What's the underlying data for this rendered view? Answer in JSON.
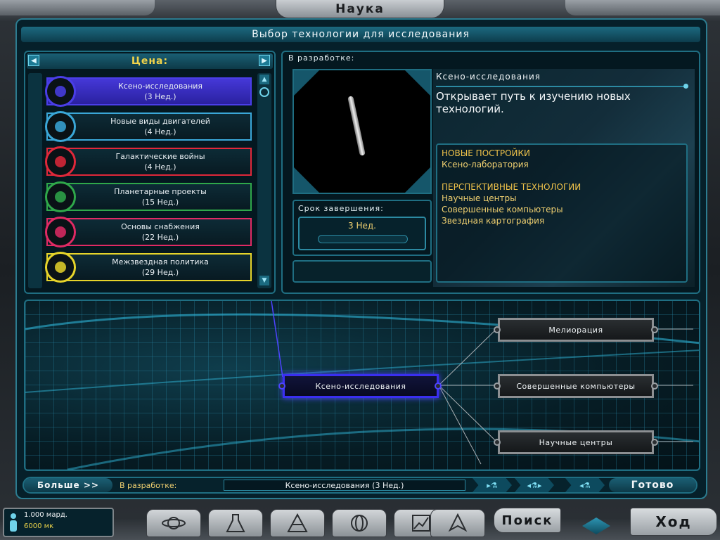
{
  "window": {
    "title": "Наука"
  },
  "header": {
    "title": "Выбор технологии для исследования"
  },
  "list": {
    "header": "Цена:",
    "prev_arrow": "◀",
    "next_arrow": "▶",
    "items": [
      {
        "name": "Ксено-исследования",
        "cost": "(3 Нед.)",
        "color": "#4a3ee8",
        "selected": true,
        "icon": "tablet-icon"
      },
      {
        "name": "Новые виды двигателей",
        "cost": "(4 Нед.)",
        "color": "#3aa7d8",
        "icon": "engine-icon"
      },
      {
        "name": "Галактические войны",
        "cost": "(4 Нед.)",
        "color": "#e0283a",
        "icon": "warship-icon"
      },
      {
        "name": "Планетарные проекты",
        "cost": "(15 Нед.)",
        "color": "#2fa84a",
        "icon": "leaf-icon"
      },
      {
        "name": "Основы снабжения",
        "cost": "(22 Нед.)",
        "color": "#e02a64",
        "icon": "supply-icon"
      },
      {
        "name": "Межзвездная политика",
        "cost": "(29 Нед.)",
        "color": "#e6d42a",
        "icon": "speech-icon"
      }
    ]
  },
  "development": {
    "header": "В разработке:",
    "tech_name": "Ксено-исследования",
    "description": "Открывает путь к изучению новых технологий.",
    "new_buildings_header": "НОВЫЕ ПОСТРОЙКИ",
    "new_buildings": [
      "Ксено-лаборатория"
    ],
    "future_tech_header": "ПЕРСПЕКТИВНЫЕ ТЕХНОЛОГИИ",
    "future_tech": [
      "Научные центры",
      "Совершенные компьютеры",
      "Звездная картография"
    ],
    "deadline_label": "Срок завершения:",
    "deadline_value": "3 Нед.",
    "progress": 0.0
  },
  "tree": {
    "nodes": [
      {
        "label": "Ксено-исследования",
        "active": true
      },
      {
        "label": "Мелиорация"
      },
      {
        "label": "Совершенные компьютеры"
      },
      {
        "label": "Научные центры"
      }
    ]
  },
  "status_bar": {
    "more_label": "Больше >>",
    "in_dev_label": "В разработке:",
    "in_dev_value": "Ксено-исследования (3 Нед.)",
    "done_label": "Готово"
  },
  "bottom": {
    "credits": "1.000 мард.",
    "mk": "6000 мк",
    "search_label": "Поиск",
    "turn_label": "Ход",
    "nav_icons": [
      "planet-icon",
      "flask-icon",
      "pyramid-icon",
      "globe-icon",
      "graph-icon",
      "ship-icon"
    ]
  },
  "colors": {
    "accent": "#2c8aa2",
    "highlight": "#f0d070",
    "active_node": "#3a2ff0"
  }
}
